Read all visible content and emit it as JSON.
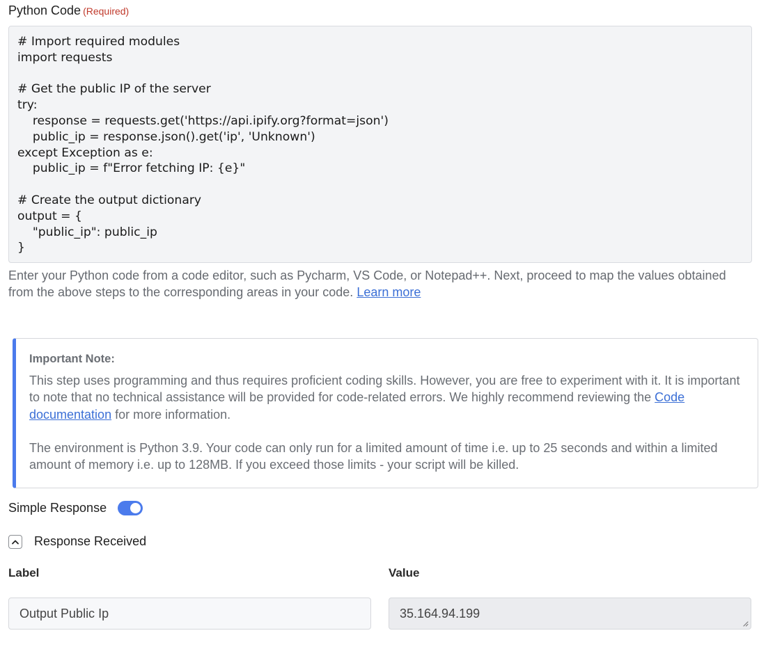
{
  "code_field": {
    "label": "Python Code",
    "required": "(Required)",
    "code": "# Import required modules\nimport requests\n\n# Get the public IP of the server\ntry:\n    response = requests.get('https://api.ipify.org?format=json')\n    public_ip = response.json().get('ip', 'Unknown')\nexcept Exception as e:\n    public_ip = f\"Error fetching IP: {e}\"\n\n# Create the output dictionary\noutput = {\n    \"public_ip\": public_ip\n}",
    "help_text": "Enter your Python code from a code editor, such as Pycharm, VS Code, or Notepad++. Next, proceed to map the values obtained from the above steps to the corresponding areas in your code.",
    "help_link": "Learn more"
  },
  "note": {
    "title": "Important Note:",
    "para1_before": "This step uses programming and thus requires proficient coding skills. However, you are free to experiment with it. It is important to note that no technical assistance will be provided for code-related errors. We highly recommend reviewing the",
    "para1_link": "Code documentation",
    "para1_after": "for more information.",
    "para2": "The environment is Python 3.9. Your code can only run for a limited amount of time i.e. up to 25 seconds and within a limited amount of memory i.e. up to 128MB. If you exceed those limits - your script will be killed."
  },
  "simple_response": {
    "label": "Simple Response",
    "enabled": true
  },
  "response_section": {
    "label": "Response Received",
    "label_header": "Label",
    "value_header": "Value",
    "row_label": "Output Public Ip",
    "row_value": "35.164.94.199"
  },
  "colors": {
    "accent": "#4b7bec",
    "required": "#c0392b"
  }
}
